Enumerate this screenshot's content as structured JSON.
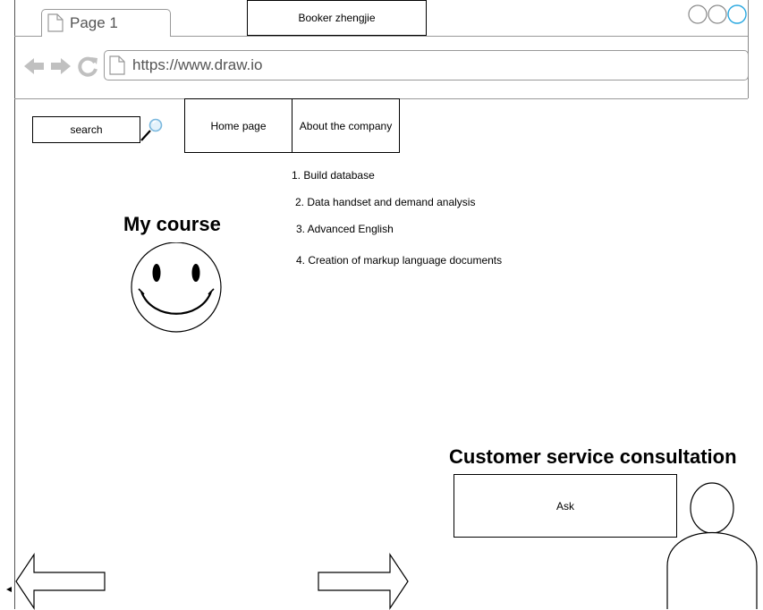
{
  "browser": {
    "tab_title": "Page 1",
    "window_title": "Booker zhengjie",
    "url": "https://www.draw.io"
  },
  "toolbar": {
    "search_label": "search"
  },
  "nav": {
    "items": [
      {
        "label": "Home page"
      },
      {
        "label": "About the company"
      }
    ]
  },
  "courses": {
    "heading": "My course",
    "items": [
      "1. Build database",
      "2. Data handset and demand analysis",
      "3. Advanced English",
      "4. Creation of markup language documents"
    ]
  },
  "service": {
    "heading": "Customer service consultation",
    "ask_label": "Ask"
  },
  "icons": {
    "tab": "page-icon",
    "back": "back-arrow-icon",
    "forward": "forward-arrow-icon",
    "reload": "reload-icon",
    "url_page": "page-icon",
    "search": "magnifier-icon",
    "smiley": "smiley-face-icon",
    "person": "person-icon",
    "nav_left": "left-arrow-icon",
    "nav_right": "right-arrow-icon",
    "window_buttons": "window-control-circles"
  },
  "colors": {
    "window_control_active": "#29a8e0",
    "chrome_gray": "#999999",
    "browser_icon_gray": "#c0c0c0"
  }
}
